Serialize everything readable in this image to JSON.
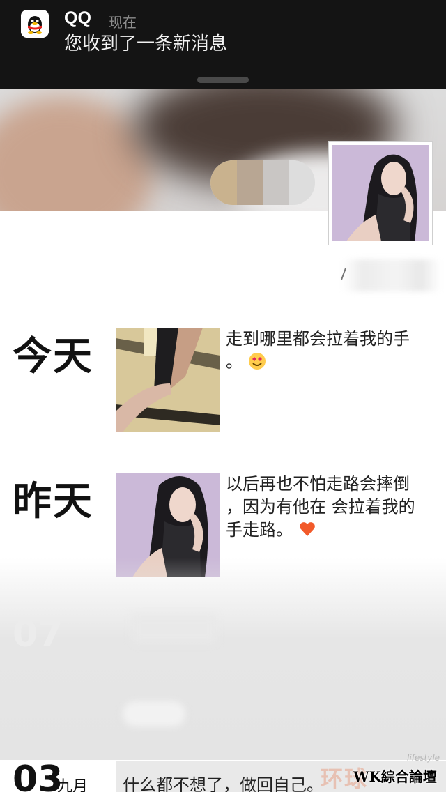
{
  "notification": {
    "app_name": "QQ",
    "time": "现在",
    "message": "您收到了一条新消息",
    "icon": "qq-penguin-icon"
  },
  "posts": [
    {
      "day": "今天",
      "text_lines": [
        "走到哪里都会拉着我的手",
        "。"
      ],
      "emoji": "smiling-face-with-heart-eyes-icon"
    },
    {
      "day": "昨天",
      "text_lines": [
        "以后再也不怕走路会摔倒",
        "，因为有他在 会拉着我的",
        "手走路。"
      ],
      "emoji": "red-heart-icon"
    }
  ],
  "faded_date": "07",
  "last_post": {
    "date_num": "03",
    "month": "九月",
    "text": "什么都不想了，做回自己。"
  },
  "watermarks": {
    "orange": "环球",
    "small": "lifestyle",
    "wk": "WK綜合論壇"
  }
}
